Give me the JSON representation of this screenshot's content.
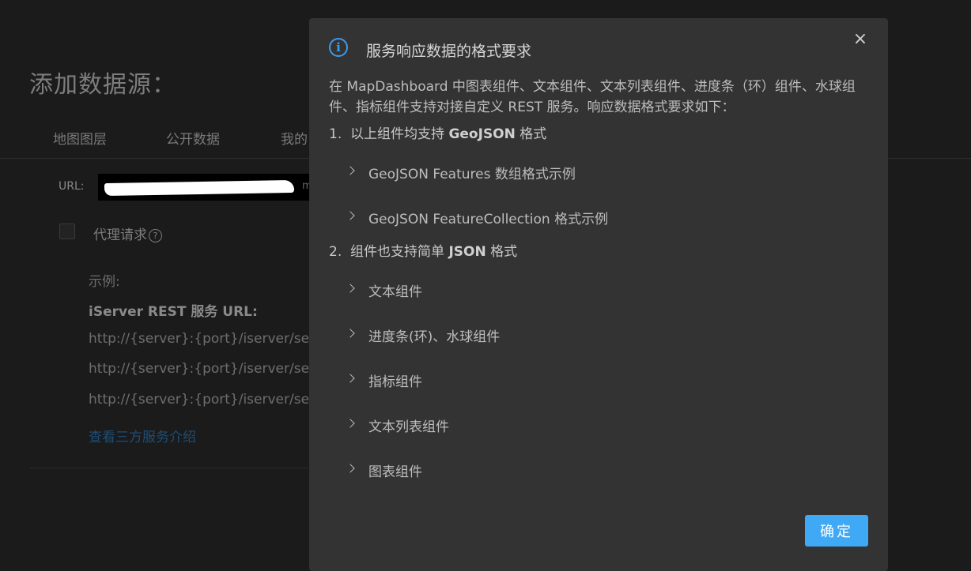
{
  "page": {
    "title": "添加数据源：",
    "tabs": [
      "地图图层",
      "公开数据",
      "我的"
    ],
    "url": {
      "label": "URL:",
      "visible_tail": "m"
    },
    "proxy": {
      "label": "代理请求",
      "help": "?"
    },
    "example": {
      "heading": "示例:",
      "service_label": "iServer REST 服务 URL:",
      "urls": [
        "http://{server}:{port}/iserver/services/",
        "http://{server}:{port}/iserver/services/",
        "http://{server}:{port}/iserver/services/"
      ],
      "link": "查看三方服务介绍"
    }
  },
  "modal": {
    "title": "服务响应数据的格式要求",
    "icon": "info-icon",
    "description": "在 MapDashboard 中图表组件、文本组件、文本列表组件、进度条（环）组件、水球组件、指标组件支持对接自定义 REST 服务。响应数据格式要求如下：",
    "sections": [
      {
        "index": "1.",
        "text": "以上组件均支持",
        "bold": "GeoJSON",
        "suffix": "格式",
        "items": [
          "GeoJSON Features 数组格式示例",
          "GeoJSON FeatureCollection 格式示例"
        ]
      },
      {
        "index": "2.",
        "text": "组件也支持简单",
        "bold": "JSON",
        "suffix": "格式",
        "items": [
          "文本组件",
          "进度条(环)、水球组件",
          "指标组件",
          "文本列表组件",
          "图表组件"
        ]
      }
    ],
    "ok_label": "确定",
    "close_label": "×",
    "accent_color": "#3fa9f5"
  }
}
